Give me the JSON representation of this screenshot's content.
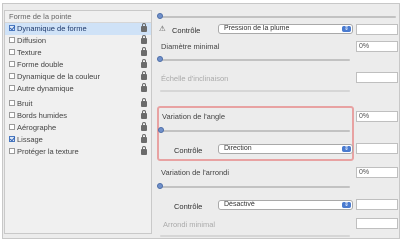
{
  "sidebar": {
    "header": "Forme de la pointe",
    "items": [
      {
        "label": "Dynamique de forme",
        "checked": true,
        "selected": true,
        "locked": true
      },
      {
        "label": "Diffusion",
        "checked": false,
        "selected": false,
        "locked": true
      },
      {
        "label": "Texture",
        "checked": false,
        "selected": false,
        "locked": true
      },
      {
        "label": "Forme double",
        "checked": false,
        "selected": false,
        "locked": true
      },
      {
        "label": "Dynamique de la couleur",
        "checked": false,
        "selected": false,
        "locked": true
      },
      {
        "label": "Autre dynamique",
        "checked": false,
        "selected": false,
        "locked": true
      },
      {
        "label": "Bruit",
        "checked": false,
        "selected": false,
        "locked": true
      },
      {
        "label": "Bords humides",
        "checked": false,
        "selected": false,
        "locked": true
      },
      {
        "label": "Aérographe",
        "checked": false,
        "selected": false,
        "locked": true
      },
      {
        "label": "Lissage",
        "checked": true,
        "selected": false,
        "locked": true
      },
      {
        "label": "Protéger la texture",
        "checked": false,
        "selected": false,
        "locked": true
      }
    ]
  },
  "main": {
    "control1": {
      "icon": "warning-icon",
      "label": "Contrôle",
      "value": "Pression de la plume"
    },
    "diameter_min": {
      "label": "Diamètre minimal",
      "value": "0%"
    },
    "tilt_scale": {
      "label": "Échelle d'inclinaison",
      "value": ""
    },
    "angle_jitter": {
      "label": "Variation de l'angle",
      "value": "0%"
    },
    "control2": {
      "label": "Contrôle",
      "value": "Direction"
    },
    "roundness_jitter": {
      "label": "Variation de l'arrondi",
      "value": "0%"
    },
    "control3": {
      "label": "Contrôle",
      "value": "Désactivé"
    },
    "roundness_min": {
      "label": "Arrondi minimal",
      "value": ""
    }
  },
  "colors": {
    "selection": "#cfe2f7",
    "highlight_border": "#e8a2a2",
    "slider_thumb": "#6f8fc9",
    "select_arrow": "#4a7bd0"
  }
}
